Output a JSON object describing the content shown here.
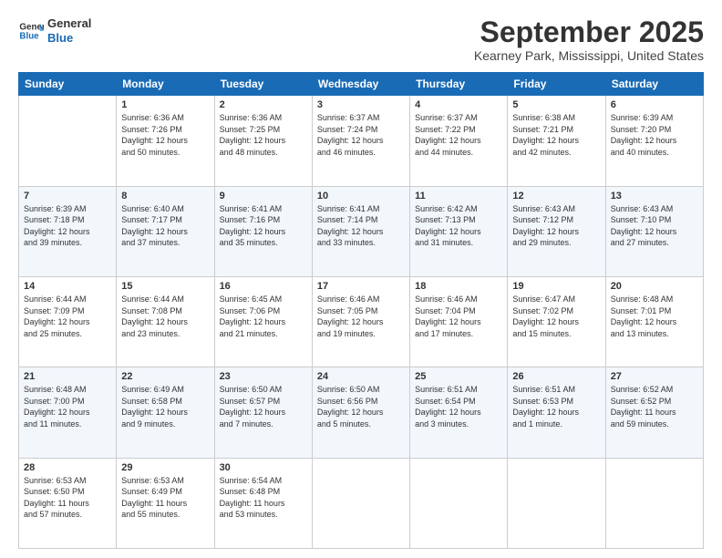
{
  "logo": {
    "line1": "General",
    "line2": "Blue"
  },
  "title": "September 2025",
  "location": "Kearney Park, Mississippi, United States",
  "days_header": [
    "Sunday",
    "Monday",
    "Tuesday",
    "Wednesday",
    "Thursday",
    "Friday",
    "Saturday"
  ],
  "weeks": [
    [
      {
        "day": "",
        "text": ""
      },
      {
        "day": "1",
        "text": "Sunrise: 6:36 AM\nSunset: 7:26 PM\nDaylight: 12 hours\nand 50 minutes."
      },
      {
        "day": "2",
        "text": "Sunrise: 6:36 AM\nSunset: 7:25 PM\nDaylight: 12 hours\nand 48 minutes."
      },
      {
        "day": "3",
        "text": "Sunrise: 6:37 AM\nSunset: 7:24 PM\nDaylight: 12 hours\nand 46 minutes."
      },
      {
        "day": "4",
        "text": "Sunrise: 6:37 AM\nSunset: 7:22 PM\nDaylight: 12 hours\nand 44 minutes."
      },
      {
        "day": "5",
        "text": "Sunrise: 6:38 AM\nSunset: 7:21 PM\nDaylight: 12 hours\nand 42 minutes."
      },
      {
        "day": "6",
        "text": "Sunrise: 6:39 AM\nSunset: 7:20 PM\nDaylight: 12 hours\nand 40 minutes."
      }
    ],
    [
      {
        "day": "7",
        "text": "Sunrise: 6:39 AM\nSunset: 7:18 PM\nDaylight: 12 hours\nand 39 minutes."
      },
      {
        "day": "8",
        "text": "Sunrise: 6:40 AM\nSunset: 7:17 PM\nDaylight: 12 hours\nand 37 minutes."
      },
      {
        "day": "9",
        "text": "Sunrise: 6:41 AM\nSunset: 7:16 PM\nDaylight: 12 hours\nand 35 minutes."
      },
      {
        "day": "10",
        "text": "Sunrise: 6:41 AM\nSunset: 7:14 PM\nDaylight: 12 hours\nand 33 minutes."
      },
      {
        "day": "11",
        "text": "Sunrise: 6:42 AM\nSunset: 7:13 PM\nDaylight: 12 hours\nand 31 minutes."
      },
      {
        "day": "12",
        "text": "Sunrise: 6:43 AM\nSunset: 7:12 PM\nDaylight: 12 hours\nand 29 minutes."
      },
      {
        "day": "13",
        "text": "Sunrise: 6:43 AM\nSunset: 7:10 PM\nDaylight: 12 hours\nand 27 minutes."
      }
    ],
    [
      {
        "day": "14",
        "text": "Sunrise: 6:44 AM\nSunset: 7:09 PM\nDaylight: 12 hours\nand 25 minutes."
      },
      {
        "day": "15",
        "text": "Sunrise: 6:44 AM\nSunset: 7:08 PM\nDaylight: 12 hours\nand 23 minutes."
      },
      {
        "day": "16",
        "text": "Sunrise: 6:45 AM\nSunset: 7:06 PM\nDaylight: 12 hours\nand 21 minutes."
      },
      {
        "day": "17",
        "text": "Sunrise: 6:46 AM\nSunset: 7:05 PM\nDaylight: 12 hours\nand 19 minutes."
      },
      {
        "day": "18",
        "text": "Sunrise: 6:46 AM\nSunset: 7:04 PM\nDaylight: 12 hours\nand 17 minutes."
      },
      {
        "day": "19",
        "text": "Sunrise: 6:47 AM\nSunset: 7:02 PM\nDaylight: 12 hours\nand 15 minutes."
      },
      {
        "day": "20",
        "text": "Sunrise: 6:48 AM\nSunset: 7:01 PM\nDaylight: 12 hours\nand 13 minutes."
      }
    ],
    [
      {
        "day": "21",
        "text": "Sunrise: 6:48 AM\nSunset: 7:00 PM\nDaylight: 12 hours\nand 11 minutes."
      },
      {
        "day": "22",
        "text": "Sunrise: 6:49 AM\nSunset: 6:58 PM\nDaylight: 12 hours\nand 9 minutes."
      },
      {
        "day": "23",
        "text": "Sunrise: 6:50 AM\nSunset: 6:57 PM\nDaylight: 12 hours\nand 7 minutes."
      },
      {
        "day": "24",
        "text": "Sunrise: 6:50 AM\nSunset: 6:56 PM\nDaylight: 12 hours\nand 5 minutes."
      },
      {
        "day": "25",
        "text": "Sunrise: 6:51 AM\nSunset: 6:54 PM\nDaylight: 12 hours\nand 3 minutes."
      },
      {
        "day": "26",
        "text": "Sunrise: 6:51 AM\nSunset: 6:53 PM\nDaylight: 12 hours\nand 1 minute."
      },
      {
        "day": "27",
        "text": "Sunrise: 6:52 AM\nSunset: 6:52 PM\nDaylight: 11 hours\nand 59 minutes."
      }
    ],
    [
      {
        "day": "28",
        "text": "Sunrise: 6:53 AM\nSunset: 6:50 PM\nDaylight: 11 hours\nand 57 minutes."
      },
      {
        "day": "29",
        "text": "Sunrise: 6:53 AM\nSunset: 6:49 PM\nDaylight: 11 hours\nand 55 minutes."
      },
      {
        "day": "30",
        "text": "Sunrise: 6:54 AM\nSunset: 6:48 PM\nDaylight: 11 hours\nand 53 minutes."
      },
      {
        "day": "",
        "text": ""
      },
      {
        "day": "",
        "text": ""
      },
      {
        "day": "",
        "text": ""
      },
      {
        "day": "",
        "text": ""
      }
    ]
  ]
}
